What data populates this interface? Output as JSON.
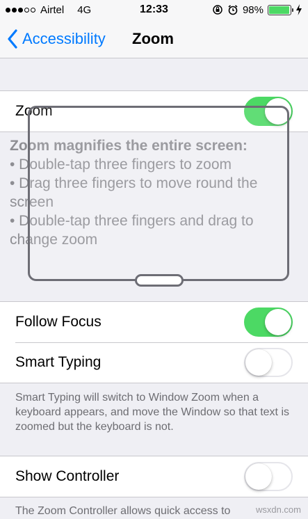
{
  "status": {
    "carrier": "Airtel",
    "network": "4G",
    "time": "12:33",
    "battery": "98%",
    "battery_level": 0.98,
    "battery_color": "#4cd964"
  },
  "nav": {
    "back_label": "Accessibility",
    "title": "Zoom"
  },
  "zoom": {
    "label": "Zoom",
    "enabled": true,
    "help": {
      "heading": "Zoom magnifies the entire screen:",
      "lines": [
        "• Double-tap three fingers to zoom",
        "• Drag three fingers to move round the screen",
        "• Double-tap three fingers and drag to change zoom"
      ]
    }
  },
  "follow_focus": {
    "label": "Follow Focus",
    "enabled": true
  },
  "smart_typing": {
    "label": "Smart Typing",
    "enabled": false,
    "footer": "Smart Typing will switch to Window Zoom when a keyboard appears, and move the Window so that text is zoomed but the keyboard is not."
  },
  "show_controller": {
    "label": "Show Controller",
    "enabled": false,
    "footer": "The Zoom Controller allows quick access to"
  },
  "watermark": "wsxdn.com",
  "colors": {
    "accent": "#007aff",
    "toggle_on": "#4cd964"
  }
}
